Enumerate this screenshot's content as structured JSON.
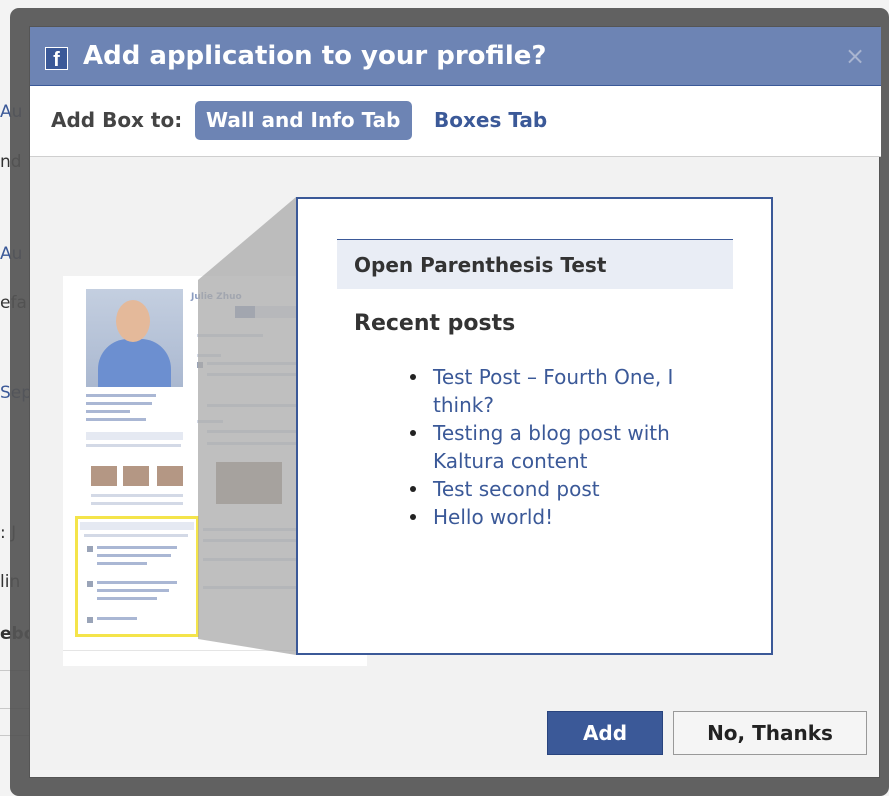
{
  "background_page": {
    "fragments": [
      "Au",
      "nd",
      "Au",
      "efa",
      "Sep",
      ": J",
      "lin",
      "ebo"
    ]
  },
  "dialog": {
    "logo": "f",
    "title": "Add application to your profile?",
    "close_label": "×",
    "tabs": {
      "label": "Add Box to:",
      "active": "Wall and Info Tab",
      "inactive": "Boxes Tab"
    },
    "profile_thumbnail": {
      "name": "Julie Zhuo"
    },
    "preview": {
      "header": "Open Parenthesis Test",
      "section_title": "Recent posts",
      "posts": [
        "Test Post – Fourth One, I think?",
        "Testing a blog post with Kaltura content",
        "Test second post",
        "Hello world!"
      ]
    },
    "buttons": {
      "add": "Add",
      "decline": "No, Thanks"
    }
  },
  "colors": {
    "title_bar": "#6d84b4",
    "brand_blue": "#3b5998",
    "highlight_yellow": "#f4e44a"
  }
}
